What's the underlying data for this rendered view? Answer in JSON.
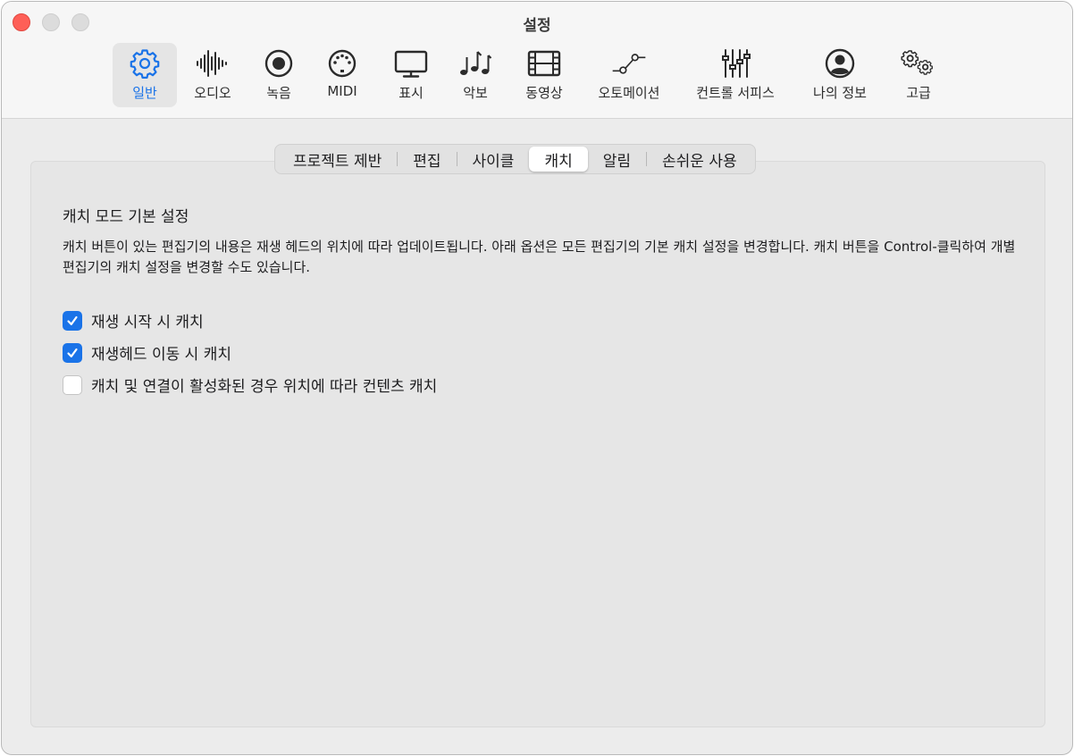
{
  "window": {
    "title": "설정"
  },
  "toolbar": {
    "items": [
      {
        "label": "일반",
        "icon": "gear-icon",
        "selected": true
      },
      {
        "label": "오디오",
        "icon": "waveform-icon"
      },
      {
        "label": "녹음",
        "icon": "record-icon"
      },
      {
        "label": "MIDI",
        "icon": "midi-connector-icon"
      },
      {
        "label": "표시",
        "icon": "display-icon"
      },
      {
        "label": "악보",
        "icon": "music-notes-icon"
      },
      {
        "label": "동영상",
        "icon": "film-icon"
      },
      {
        "label": "오토메이션",
        "icon": "automation-icon"
      },
      {
        "label": "컨트롤 서피스",
        "icon": "sliders-icon"
      },
      {
        "label": "나의 정보",
        "icon": "person-icon"
      },
      {
        "label": "고급",
        "icon": "gears-icon"
      }
    ]
  },
  "tabs": [
    {
      "label": "프로젝트 제반"
    },
    {
      "label": "편집"
    },
    {
      "label": "사이클"
    },
    {
      "label": "캐치",
      "active": true
    },
    {
      "label": "알림"
    },
    {
      "label": "손쉬운 사용"
    }
  ],
  "catch": {
    "title": "캐치 모드 기본 설정",
    "description": "캐치 버튼이 있는 편집기의 내용은 재생 헤드의 위치에 따라 업데이트됩니다. 아래 옵션은 모든 편집기의 기본 캐치 설정을 변경합니다. 캐치 버튼을 Control-클릭하여 개별 편집기의 캐치 설정을 변경할 수도 있습니다.",
    "options": [
      {
        "label": "재생 시작 시 캐치",
        "checked": true
      },
      {
        "label": "재생헤드 이동 시 캐치",
        "checked": true
      },
      {
        "label": "캐치 및 연결이 활성화된 경우 위치에 따라 컨텐츠 캐치",
        "checked": false
      }
    ]
  },
  "colors": {
    "accent": "#1a73e8",
    "close": "#fe5f57"
  }
}
